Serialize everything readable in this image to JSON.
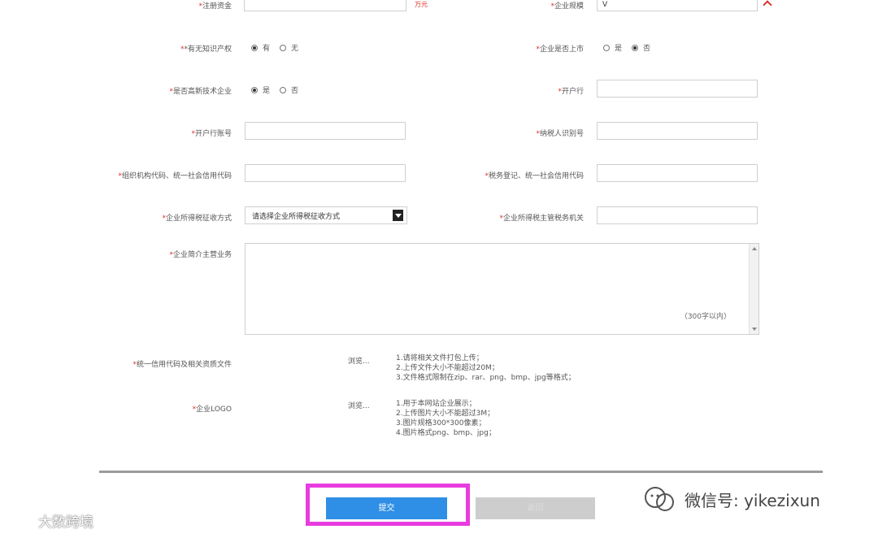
{
  "form": {
    "top_left_label": "*注册资金",
    "top_left_unit": "万元",
    "top_right_label": "*企业规模",
    "top_right_value": "V",
    "ip_label": "*有无知识产权",
    "ip_options": [
      "有",
      "无"
    ],
    "listed_label": "*企业是否上市",
    "listed_options": [
      "是",
      "否"
    ],
    "hightech_label": "*是否高新技术企业",
    "hightech_options": [
      "是",
      "否"
    ],
    "bank_label": "*开户行",
    "bank_value": "",
    "account_label": "*开户行账号",
    "account_value": "",
    "taxid_label": "*纳税人识别号",
    "taxid_value": "",
    "orgcode_label": "*组织机构代码、统一社会信用代码",
    "orgcode_value": "",
    "taxreg_label": "*税务登记、统一社会信用代码",
    "taxreg_value": "",
    "taxmode_label": "*企业所得税征收方式",
    "taxmode_select": "请选择企业所得税征收方式",
    "taxauthority_label": "*企业所得税主管税务机关",
    "taxauthority_value": "",
    "intro_label": "*企业简介主营业务",
    "intro_hint": "（300字以内）",
    "license_label": "*统一信用代码及相关资质文件",
    "license_browse": "浏览...",
    "license_notes": [
      "1.请将相关文件打包上传；",
      "2.上传文件大小不能超过20M；",
      "3.文件格式限制在zip、rar、png、bmp、jpg等格式；"
    ],
    "logo_label": "*企业LOGO",
    "logo_browse": "浏览...",
    "logo_notes": [
      "1.用于本网站企业展示；",
      "2.上传图片大小不能超过3M；",
      "3.图片规格300*300像素；",
      "4.图片格式png、bmp、jpg；"
    ]
  },
  "actions": {
    "submit_label": "提交",
    "other_label": "返回"
  },
  "watermarks": {
    "right": "微信号: yikezixun",
    "left": "大数跨境"
  },
  "colors": {
    "required": "#e0302a",
    "submit": "#2f8fe6",
    "highlight": "#e83ce0"
  }
}
